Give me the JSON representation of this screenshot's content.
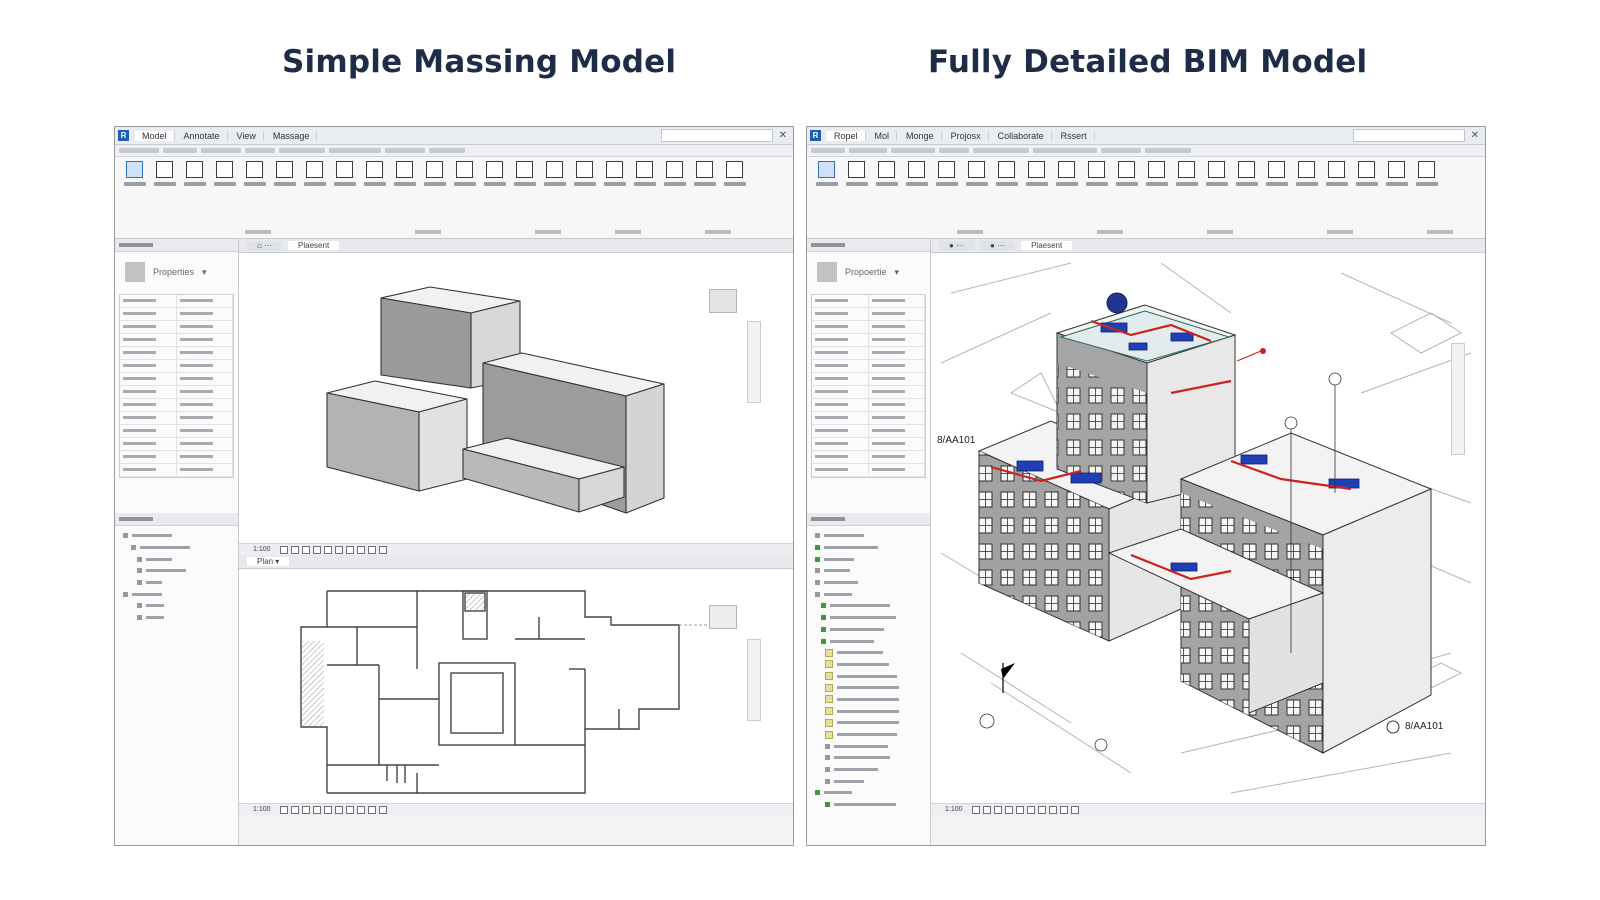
{
  "headings": {
    "left": "Simple Massing Model",
    "right": "Fully Detailed BIM Model"
  },
  "left_window": {
    "tabs": [
      "Model",
      "Annotate",
      "View",
      "Massage"
    ],
    "properties_label": "Properties",
    "view_tab": "Plaesent"
  },
  "right_window": {
    "tabs": [
      "Ropel",
      "Mol",
      "Monge",
      "Projosx",
      "Collaborate",
      "Rssert"
    ],
    "properties_label": "Propoertie",
    "view_tab": "Plaesent",
    "tags": [
      "8/AA101",
      "8/AA101"
    ]
  },
  "icons": [
    "revit-logo-icon",
    "close-icon",
    "view-cube-icon",
    "navigation-bar-icon",
    "section-flag-icon",
    "folder-icon"
  ],
  "colors": {
    "heading": "#1f2c47",
    "accent_blue": "#1d5fb6",
    "duct_red": "#cc2222",
    "equipment_blue": "#1f3fb5"
  }
}
